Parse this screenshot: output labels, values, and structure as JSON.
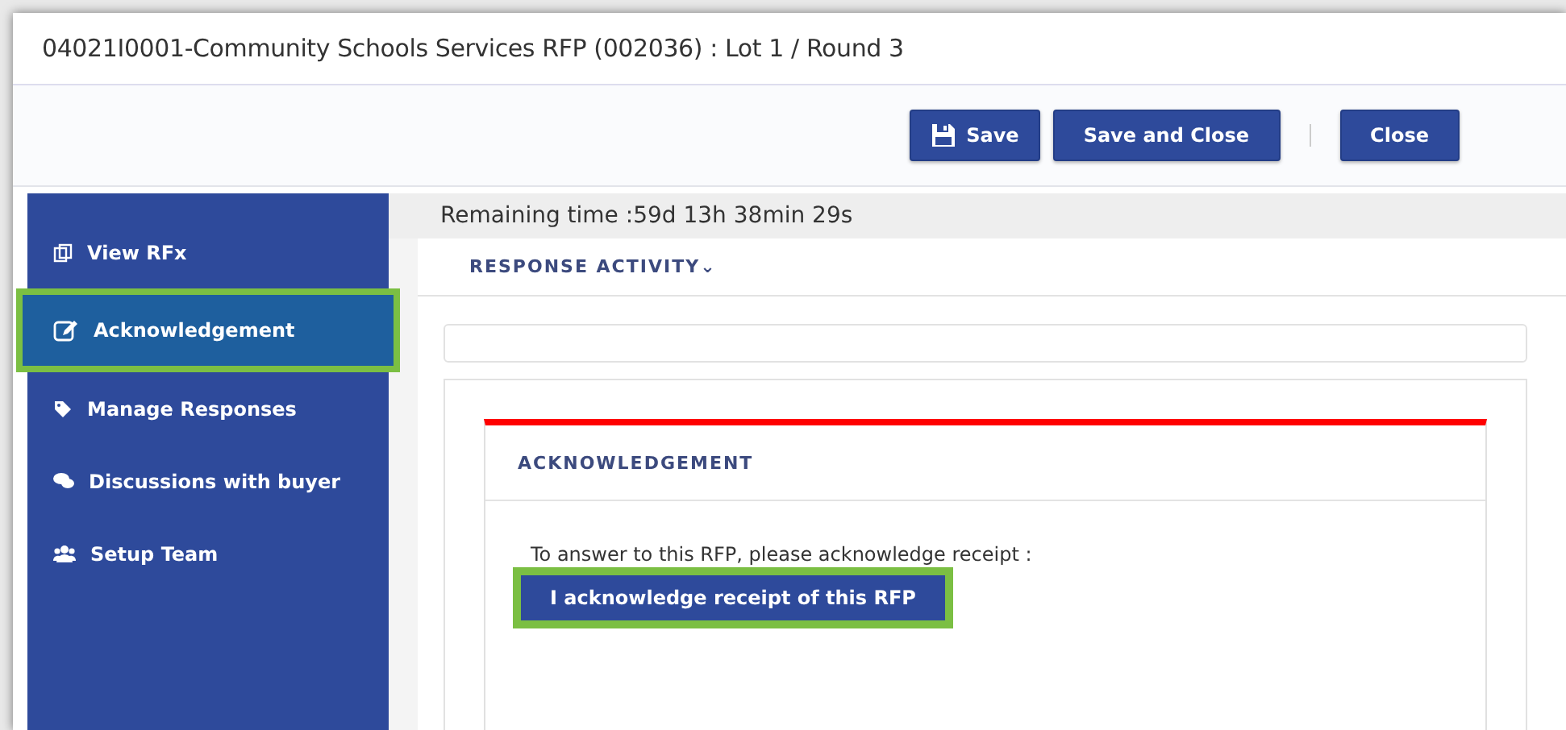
{
  "window": {
    "title": "04021I0001-Community Schools Services RFP (002036) : Lot 1 / Round 3"
  },
  "toolbar": {
    "buttons": [
      {
        "label": "Save",
        "kind": "save"
      },
      {
        "label": "Save and Close",
        "kind": "plain"
      },
      {
        "label": "Close",
        "kind": "plain"
      }
    ]
  },
  "sidebar": {
    "items": [
      {
        "label": "View RFx",
        "selected": false,
        "highlighted": false
      },
      {
        "label": "Acknowledgement",
        "selected": true,
        "highlighted": true
      },
      {
        "label": "Manage Responses",
        "selected": false,
        "highlighted": false
      },
      {
        "label": "Discussions with buyer",
        "selected": false,
        "highlighted": false
      },
      {
        "label": "Setup Team",
        "selected": false,
        "highlighted": false
      }
    ]
  },
  "remaining_time": "Remaining time :59d 13h 38min 29s",
  "section_menu": {
    "label": "RESPONSE ACTIVITY",
    "caret": "⌄"
  },
  "acknowledgement": {
    "heading": "ACKNOWLEDGEMENT",
    "text": "To answer to this RFP, please acknowledge receipt :",
    "button": {
      "label": "I acknowledge receipt of this RFP",
      "highlighted": true
    }
  }
}
